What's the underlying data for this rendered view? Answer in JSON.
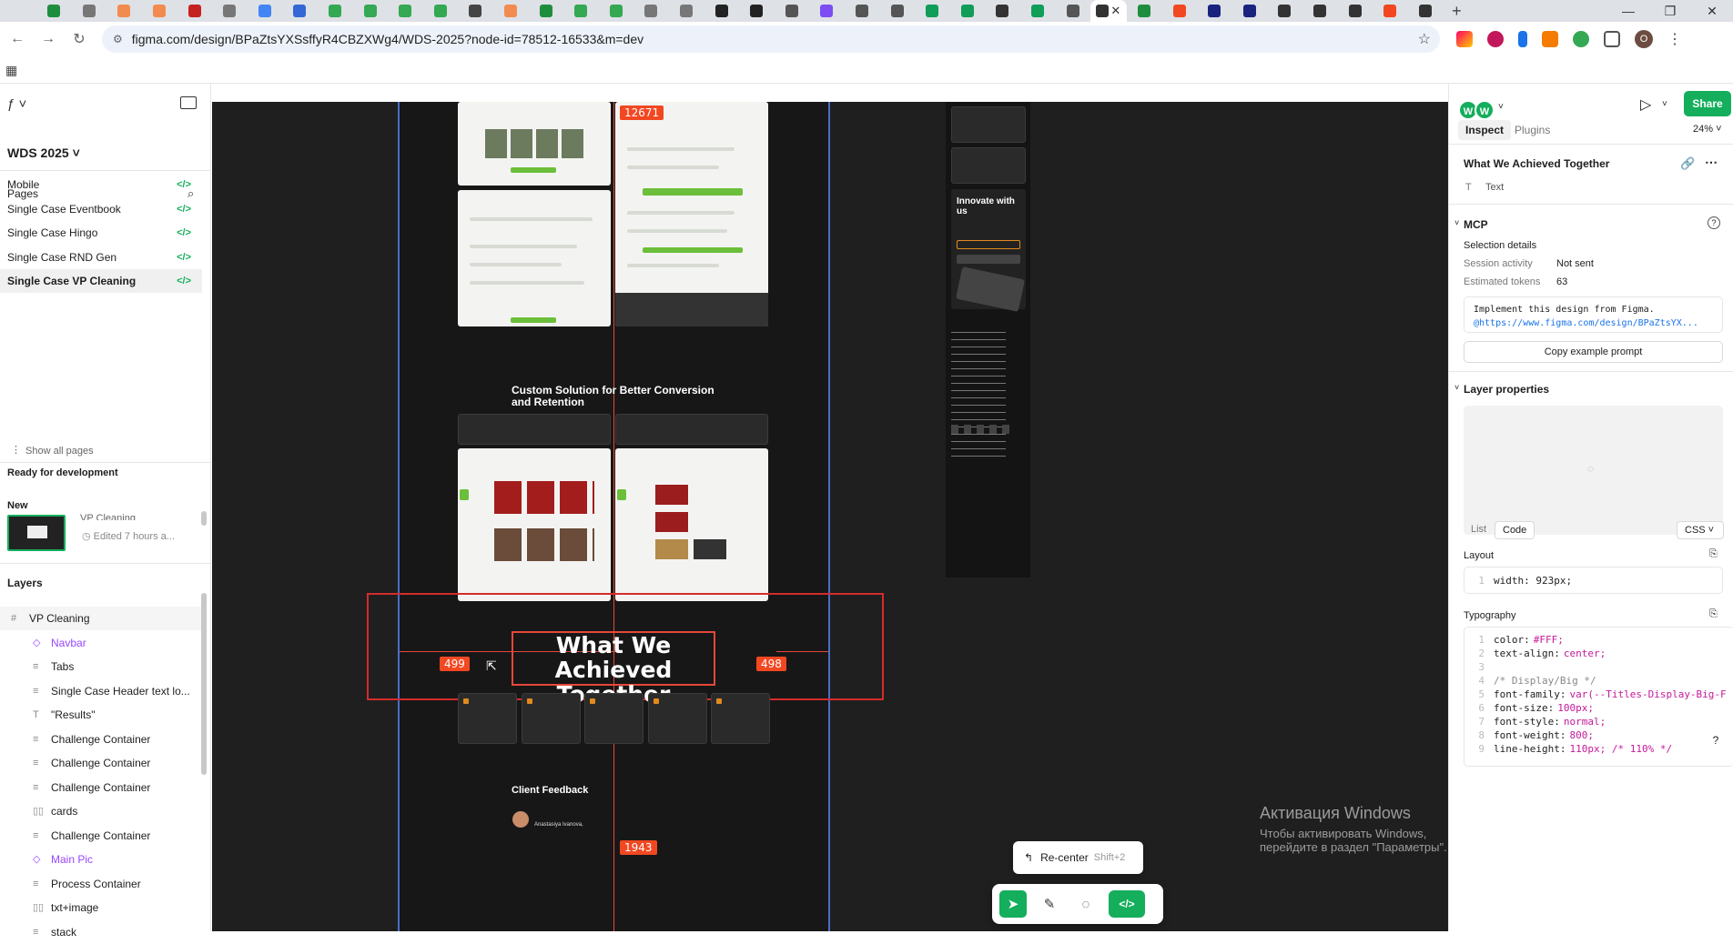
{
  "browser": {
    "tab_favicon_colors": [
      "#1e8e3e",
      "#777",
      "#f28b50",
      "#f28b50",
      "#c5221f",
      "#777",
      "#4285f4",
      "#3367d6",
      "#34a853",
      "#34a853",
      "#34a853",
      "#34a853",
      "#444",
      "#f28b50",
      "#1e8e3e",
      "#34a853",
      "#34a853",
      "#777",
      "#777",
      "#222",
      "#222",
      "#555",
      "#7b4df2",
      "#555",
      "#555",
      "#0f9d58",
      "#0f9d58",
      "#333",
      "#0f9d58",
      "#555",
      "#333",
      "#1e8e3e",
      "#f24822",
      "#1a237e",
      "#1a237e",
      "#333",
      "#333",
      "#333",
      "#f24822",
      "#333"
    ],
    "active_tab_close": "✕",
    "new_tab": "+",
    "url": "figma.com/design/BPaZtsYXSsffyR4CBZXWg4/WDS-2025?node-id=78512-16533&m=dev",
    "profile_initial": "O",
    "window_controls": [
      "—",
      "❐",
      "✕"
    ]
  },
  "left_panel": {
    "file_name": "WDS 2025",
    "pages_header": "Pages",
    "pages": [
      {
        "label": "Mobile",
        "selected": false
      },
      {
        "label": "Single Case Eventbook",
        "selected": false
      },
      {
        "label": "Single Case Hingo",
        "selected": false
      },
      {
        "label": "Single Case RND Gen",
        "selected": false
      },
      {
        "label": "Single Case VP Cleaning",
        "selected": true
      }
    ],
    "show_all_pages": "Show all pages",
    "ready_header": "Ready for development",
    "new_label": "New",
    "recent_item_title": "VP Cleaning",
    "recent_item_meta": "Edited 7 hours a...",
    "layers_header": "Layers",
    "layers": [
      {
        "label": "VP Cleaning",
        "icon": "#",
        "type": "frame"
      },
      {
        "label": "Navbar",
        "icon": "◇",
        "type": "component"
      },
      {
        "label": "Tabs",
        "icon": "≡",
        "type": "frame"
      },
      {
        "label": "Single Case Header text lo...",
        "icon": "≡",
        "type": "frame"
      },
      {
        "label": "\"Results\"",
        "icon": "T",
        "type": "text"
      },
      {
        "label": "Challenge Container",
        "icon": "≡",
        "type": "frame"
      },
      {
        "label": "Challenge Container",
        "icon": "≡",
        "type": "frame"
      },
      {
        "label": "Challenge Container",
        "icon": "≡",
        "type": "frame"
      },
      {
        "label": "cards",
        "icon": "▯▯",
        "type": "frame"
      },
      {
        "label": "Challenge Container",
        "icon": "≡",
        "type": "frame"
      },
      {
        "label": "Main Pic",
        "icon": "◇",
        "type": "component"
      },
      {
        "label": "Process Container",
        "icon": "≡",
        "type": "frame"
      },
      {
        "label": "txt+image",
        "icon": "▯▯",
        "type": "frame"
      },
      {
        "label": "stack",
        "icon": "≡",
        "type": "frame"
      }
    ]
  },
  "canvas": {
    "badge_top": "12671",
    "section_heading": "Custom Solution for Better Conversion and Retention",
    "selected_text": "What We Achieved Together",
    "dist_left": "499",
    "dist_right": "498",
    "badge_bottom": "1943",
    "client_feedback": "Client Feedback",
    "reviewer_name": "Anastasiya Ivanova,",
    "innovate_title": "Innovate with us",
    "recenter_label": "Re-center",
    "recenter_shortcut": "Shift+2",
    "windows_activation_title": "Активация Windows",
    "windows_activation_text": "Чтобы активировать Windows, перейдите в раздел \"Параметры\"."
  },
  "right_panel": {
    "avatars": [
      "W",
      "W"
    ],
    "share": "Share",
    "tabs": [
      "Inspect",
      "Plugins"
    ],
    "zoom": "24%",
    "layer_name": "What We Achieved Together",
    "layer_type": "Text",
    "mcp_header": "MCP",
    "selection_details": "Selection details",
    "session_activity_label": "Session activity",
    "session_activity_value": "Not sent",
    "tokens_label": "Estimated tokens",
    "tokens_value": "63",
    "prompt_line1": "Implement this design from Figma.",
    "prompt_line2": "@https://www.figma.com/design/BPaZtsYX...",
    "copy_prompt": "Copy example prompt",
    "layer_props_header": "Layer properties",
    "view_list": "List",
    "view_code": "Code",
    "lang": "CSS",
    "layout_header": "Layout",
    "layout_code": "width: 923px;",
    "typography_header": "Typography",
    "typography_code": [
      {
        "k": "color:",
        "v": "#FFF;"
      },
      {
        "k": "text-align:",
        "v": "center;"
      },
      {
        "k": "",
        "v": ""
      },
      {
        "k": "/* Display/Big */",
        "v": ""
      },
      {
        "k": "font-family:",
        "v": "var(--Titles-Display-Big-F"
      },
      {
        "k": "font-size:",
        "v": "100px;"
      },
      {
        "k": "font-style:",
        "v": "normal;"
      },
      {
        "k": "font-weight:",
        "v": "800;"
      },
      {
        "k": "line-height:",
        "v": "110px; /* 110% */"
      }
    ],
    "help": "?"
  }
}
